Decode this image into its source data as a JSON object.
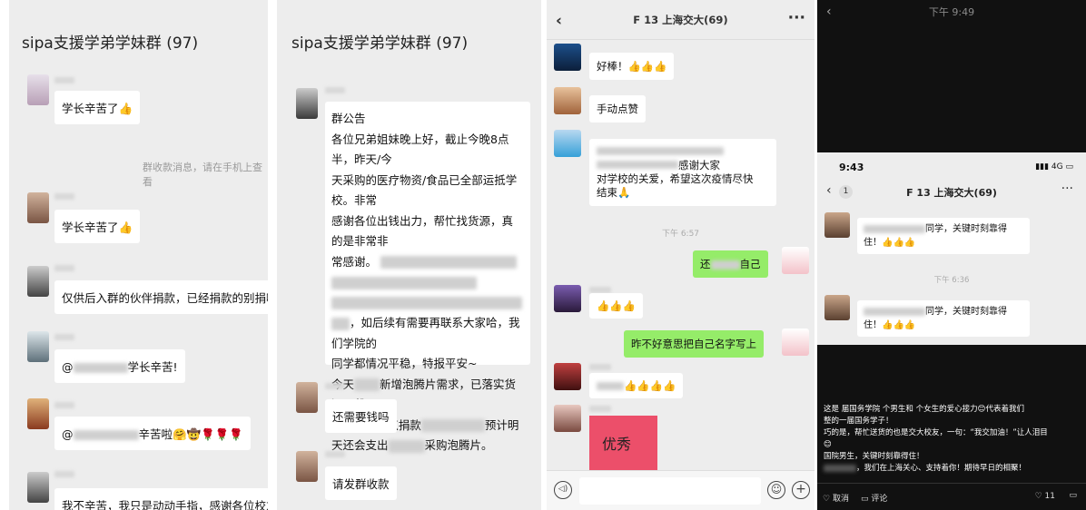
{
  "panel1": {
    "group_title": "sipa支援学弟学妹群 (97)",
    "messages": [
      {
        "text": "学长辛苦了👍"
      },
      {
        "text": "学长辛苦了👍"
      },
      {
        "text": "仅供后入群的伙伴捐款，已经捐款的别捐啦"
      },
      {
        "text_prefix": "@",
        "text_suffix": "学长辛苦!"
      },
      {
        "text_prefix": "@",
        "text_suffix": "辛苦啦🤗🤠🌹🌹🌹"
      },
      {
        "text": "我不辛苦，我只是动动手指，感谢各位校友出钱"
      }
    ],
    "system_note": "群收款消息，请在手机上查看"
  },
  "panel2": {
    "group_title": "sipa支援学弟学妹群 (97)",
    "notice_lines": [
      "群公告",
      "各位兄弟姐妹晚上好，截止今晚8点半，昨天/今",
      "天采购的医疗物资/食品已全部运抵学校。非常",
      "感谢各位出钱出力，帮忙找货源，真的是非常非",
      "常感谢。",
      "",
      "",
      "，如后续有需要再联系大家哈，我们学院的",
      "同学都情况平稳，特报平安~",
      "今天",
      "止14日晚9点捐款",
      "天还会支出"
    ],
    "notice_inline": {
      "line10_tail": "新增泡腾片需求，已落实货源。截",
      "line11_tail": "预计明",
      "line12_tail": "采购泡腾片。"
    },
    "messages": [
      {
        "text": "还需要钱吗"
      },
      {
        "text": "请发群收款"
      }
    ]
  },
  "panel3": {
    "title": "F   13 上海交大(69)",
    "back_icon": "‹",
    "more_icon": "···",
    "messages": [
      {
        "text": "好棒！👍👍👍"
      },
      {
        "text": "手动点赞"
      },
      {
        "text_line1_tail": "感谢大家",
        "text_line2": "对学校的关爱，希望这次疫情尽快",
        "text_line3": "结束🙏"
      },
      {
        "text_prefix": "还",
        "text_suffix": "自己"
      },
      {
        "text": "👍👍👍"
      },
      {
        "text": "昨不好意思把自己名字写上"
      },
      {
        "text": "👍👍👍👍"
      },
      {
        "text": "优秀"
      }
    ],
    "time_label": "下午 6:57"
  },
  "panel4": {
    "top_time": "下午 9:49",
    "status_time": "9:43",
    "signal": "4G",
    "back_count": "1",
    "chat_title": "F   13 上海交大(69)",
    "messages": [
      {
        "text_suffix": "同学，关键时刻靠得",
        "text_line2": "住！👍👍👍"
      },
      {
        "text_suffix": "同学，关键时刻靠得",
        "text_line2": "住！👍👍👍"
      }
    ],
    "time_label": "下午 6:36",
    "caption_lines": [
      "这是  届国务学院  个男生和  个女生的爱心接力😊代表着我们",
      "整的一届国务学子！",
      "巧的是，帮忙送货的也是交大校友，一句：“我交加油！”让人泪目",
      "😊",
      "国院男生，关键时刻靠得住！",
      "，我们在上海关心、支持着你！期待早日的相聚！"
    ],
    "footer": {
      "cancel": "取消",
      "comment": "评论",
      "likes": "11"
    }
  },
  "colors": {
    "wechat_green": "#95ec69",
    "chat_bg": "#ededed"
  }
}
